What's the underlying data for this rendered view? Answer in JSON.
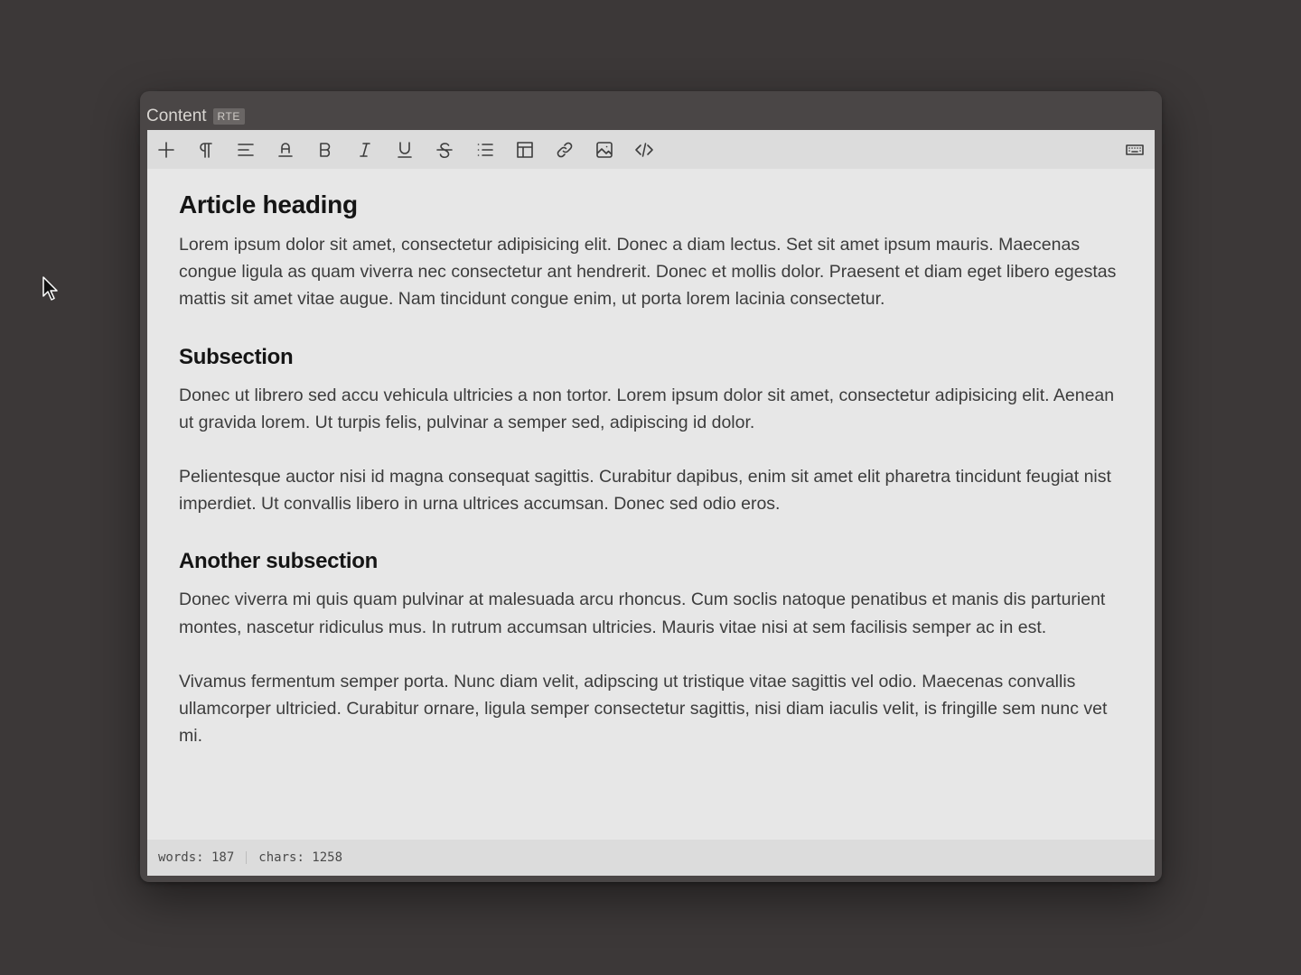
{
  "field": {
    "label": "Content",
    "badge": "RTE"
  },
  "toolbar": {
    "tools": [
      {
        "icon": "plus-icon"
      },
      {
        "icon": "paragraph-icon"
      },
      {
        "icon": "align-left-icon"
      },
      {
        "icon": "text-color-icon"
      },
      {
        "icon": "bold-icon"
      },
      {
        "icon": "italic-icon"
      },
      {
        "icon": "underline-icon"
      },
      {
        "icon": "strikethrough-icon"
      },
      {
        "icon": "bullet-list-icon"
      },
      {
        "icon": "table-icon"
      },
      {
        "icon": "link-icon"
      },
      {
        "icon": "image-icon"
      },
      {
        "icon": "code-icon"
      },
      {
        "icon": "keyboard-icon"
      }
    ]
  },
  "document": {
    "heading": "Article heading",
    "intro": "Lorem ipsum dolor sit amet, consectetur adipisicing elit. Donec a diam lectus. Set sit amet ipsum mauris. Maecenas congue ligula as quam viverra nec consectetur ant hendrerit. Donec et mollis dolor. Praesent et diam eget libero egestas mattis sit amet vitae augue. Nam tincidunt congue enim, ut porta lorem lacinia consectetur.",
    "subsection1_title": "Subsection",
    "subsection1_p1": "Donec ut librero sed accu vehicula ultricies a non tortor. Lorem ipsum dolor sit amet, consectetur adipisicing elit. Aenean ut gravida lorem. Ut turpis felis, pulvinar a semper sed, adipiscing id dolor.",
    "subsection1_p2": "Pelientesque auctor nisi id magna consequat sagittis. Curabitur dapibus, enim sit amet elit pharetra tincidunt feugiat nist imperdiet. Ut convallis libero in urna ultrices accumsan. Donec sed odio eros.",
    "subsection2_title": "Another subsection",
    "subsection2_p1": "Donec viverra mi quis quam pulvinar at malesuada arcu rhoncus. Cum soclis natoque penatibus et manis dis parturient montes, nascetur ridiculus mus. In rutrum accumsan ultricies. Mauris vitae nisi at sem facilisis semper ac in est.",
    "subsection2_p2": "Vivamus fermentum semper porta. Nunc diam velit, adipscing ut tristique vitae sagittis vel odio. Maecenas convallis ullamcorper ultricied. Curabitur ornare, ligula semper consectetur sagittis, nisi diam iaculis velit, is fringille sem nunc vet mi."
  },
  "status": {
    "words": "words: 187",
    "chars": "chars: 1258"
  }
}
